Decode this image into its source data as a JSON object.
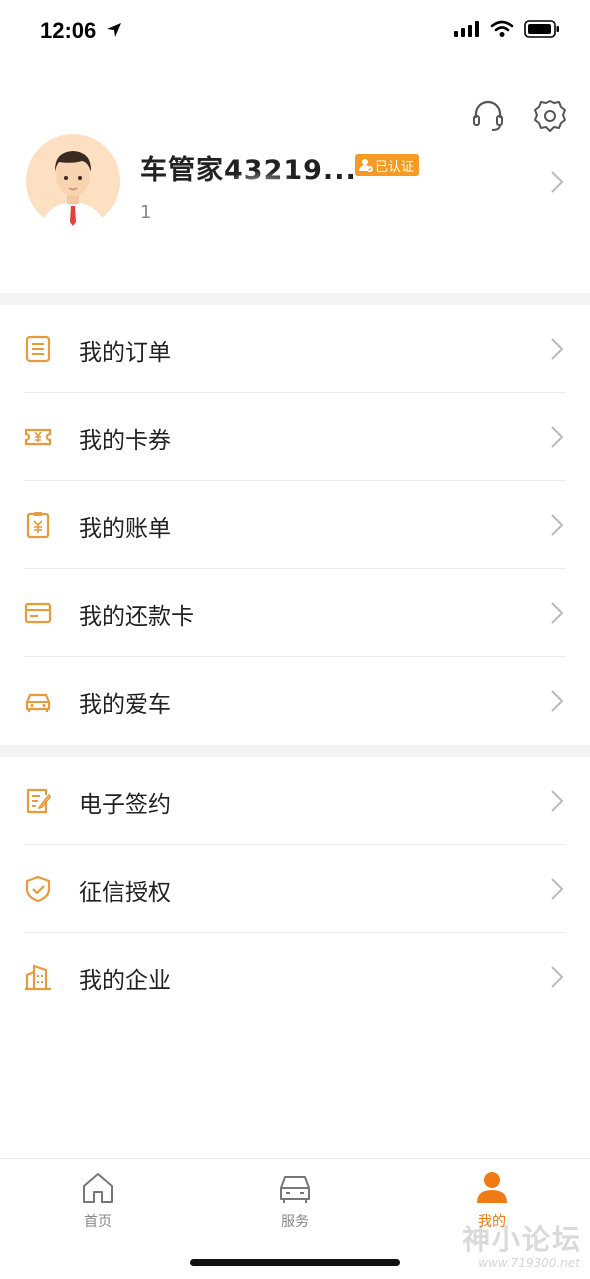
{
  "status_bar": {
    "time": "12:06"
  },
  "profile": {
    "name": "车管家43219...",
    "verified_badge": "已认证",
    "sub_text": "1"
  },
  "menu_group_1": [
    {
      "label": "我的订单",
      "icon": "order-list-icon"
    },
    {
      "label": "我的卡券",
      "icon": "coupon-icon"
    },
    {
      "label": "我的账单",
      "icon": "bill-icon"
    },
    {
      "label": "我的还款卡",
      "icon": "repayment-card-icon"
    },
    {
      "label": "我的爱车",
      "icon": "car-icon"
    }
  ],
  "menu_group_2": [
    {
      "label": "电子签约",
      "icon": "e-sign-icon"
    },
    {
      "label": "征信授权",
      "icon": "credit-shield-icon"
    },
    {
      "label": "我的企业",
      "icon": "enterprise-building-icon"
    }
  ],
  "tabbar": {
    "home": "首页",
    "service": "服务",
    "mine": "我的",
    "active": "mine"
  },
  "watermark": {
    "main": "神小论坛",
    "sub": "www.719300.net"
  },
  "colors": {
    "accent": "#f07b14",
    "icon": "#e89a3c",
    "badge": "#f59a23",
    "divider": "#ececec"
  }
}
